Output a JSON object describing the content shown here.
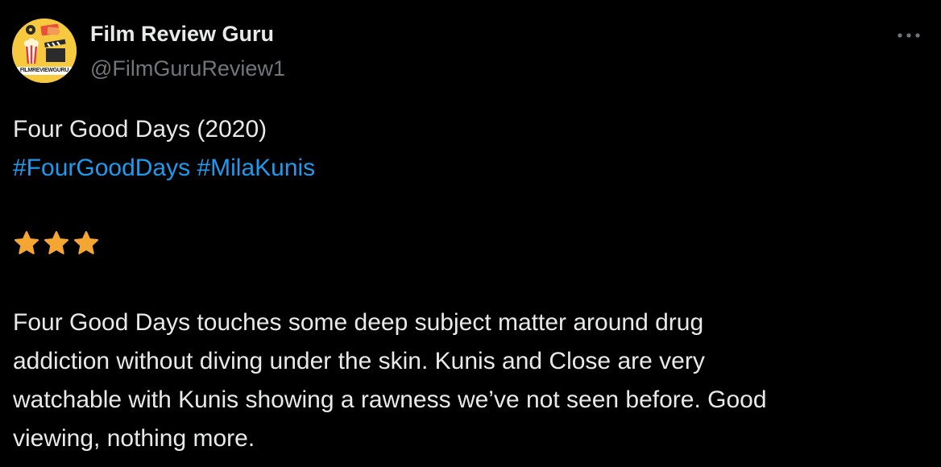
{
  "author": {
    "display_name": "Film Review Guru",
    "handle": "@FilmGuruReview1",
    "avatar_text": "FILMREVIEWGURU"
  },
  "more_icon": "more-horizontal-icon",
  "tweet": {
    "title_line": "Four Good Days (2020)",
    "hashtags": [
      "#FourGoodDays",
      "#MilaKunis"
    ],
    "rating": {
      "icon": "star-icon",
      "stars": 3,
      "star_color": "#f4a632"
    },
    "review_lines": [
      "Four Good Days touches some deep subject matter around drug",
      "addiction without diving under the skin. Kunis and Close are very",
      "watchable with Kunis showing a rawness we’ve not seen before. Good",
      "viewing, nothing more."
    ]
  },
  "colors": {
    "background": "#000000",
    "text": "#e7e9ea",
    "secondary": "#71767b",
    "link": "#1d9bf0",
    "avatar_bg": "#f6c93f"
  }
}
